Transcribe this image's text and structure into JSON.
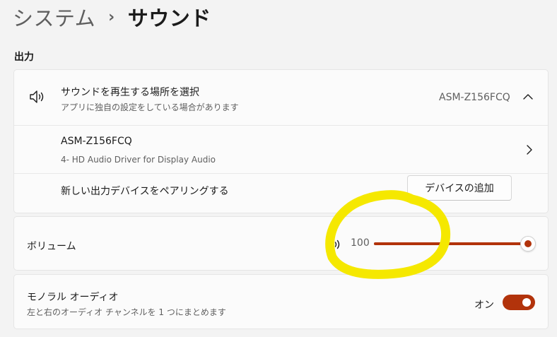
{
  "breadcrumb": {
    "parent": "システム",
    "separator": "›",
    "current": "サウンド"
  },
  "output_section": {
    "title": "出力",
    "choose_device": {
      "title": "サウンドを再生する場所を選択",
      "subtitle": "アプリに独自の設定をしている場合があります",
      "selected_device": "ASM-Z156FCQ",
      "icon": "speaker-icon",
      "expanded": true
    },
    "device": {
      "name": "ASM-Z156FCQ",
      "description": "4- HD Audio Driver for Display Audio"
    },
    "pair_device": {
      "label": "新しい出力デバイスをペアリングする",
      "button_label": "デバイスの追加"
    }
  },
  "volume": {
    "label": "ボリューム",
    "value_text": "100",
    "level": 100,
    "icon": "speaker-icon"
  },
  "mono_audio": {
    "title": "モノラル オーディオ",
    "subtitle": "左と右のオーディオ チャンネルを 1 つにまとめます",
    "state_label": "オン",
    "on": true
  },
  "colors": {
    "accent": "#b2330b",
    "annotation": "#f5e800"
  }
}
